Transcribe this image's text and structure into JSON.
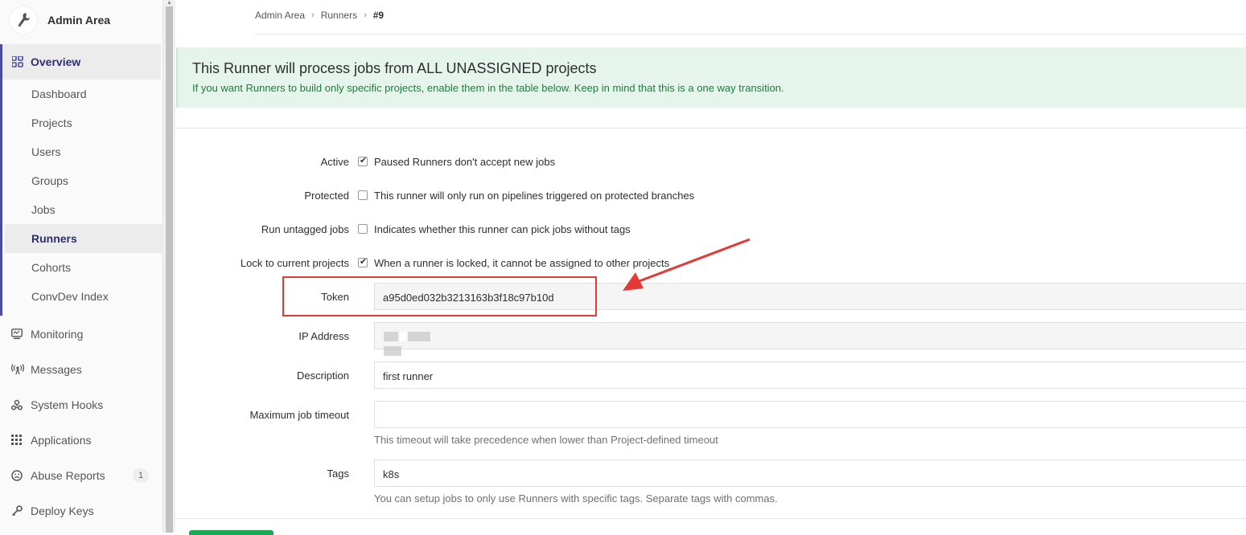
{
  "sidebar": {
    "brand": "Admin Area",
    "overview_label": "Overview",
    "sub_items": [
      "Dashboard",
      "Projects",
      "Users",
      "Groups",
      "Jobs",
      "Runners",
      "Cohorts",
      "ConvDev Index"
    ],
    "active_sub_item": "Runners",
    "items": [
      {
        "label": "Monitoring",
        "icon": "monitor-icon"
      },
      {
        "label": "Messages",
        "icon": "broadcast-icon"
      },
      {
        "label": "System Hooks",
        "icon": "hook-icon"
      },
      {
        "label": "Applications",
        "icon": "grid-icon"
      },
      {
        "label": "Abuse Reports",
        "icon": "face-icon",
        "badge": "1"
      },
      {
        "label": "Deploy Keys",
        "icon": "key-icon"
      }
    ]
  },
  "breadcrumb": {
    "items": [
      "Admin Area",
      "Runners"
    ],
    "current": "#9"
  },
  "alert": {
    "title": "This Runner will process jobs from ALL UNASSIGNED projects",
    "text": "If you want Runners to build only specific projects, enable them in the table below. Keep in mind that this is a one way transition."
  },
  "form": {
    "active": {
      "label": "Active",
      "checked": true,
      "text": "Paused Runners don't accept new jobs"
    },
    "protected": {
      "label": "Protected",
      "checked": false,
      "text": "This runner will only run on pipelines triggered on protected branches"
    },
    "untagged": {
      "label": "Run untagged jobs",
      "checked": false,
      "text": "Indicates whether this runner can pick jobs without tags"
    },
    "locked": {
      "label": "Lock to current projects",
      "checked": true,
      "text": "When a runner is locked, it cannot be assigned to other projects"
    },
    "token": {
      "label": "Token",
      "value": "a95d0ed032b3213163b3f18c97b10d"
    },
    "ip": {
      "label": "IP Address",
      "value": ""
    },
    "description": {
      "label": "Description",
      "value": "first runner"
    },
    "timeout": {
      "label": "Maximum job timeout",
      "value": "",
      "help": "This timeout will take precedence when lower than Project-defined timeout"
    },
    "tags": {
      "label": "Tags",
      "value": "k8s",
      "help": "You can setup jobs to only use Runners with specific tags. Separate tags with commas."
    }
  },
  "colors": {
    "accent": "#4b4ba3",
    "alert_bg": "#e5f5ec",
    "alert_text": "#1a7f37",
    "annotation": "#e53935"
  }
}
